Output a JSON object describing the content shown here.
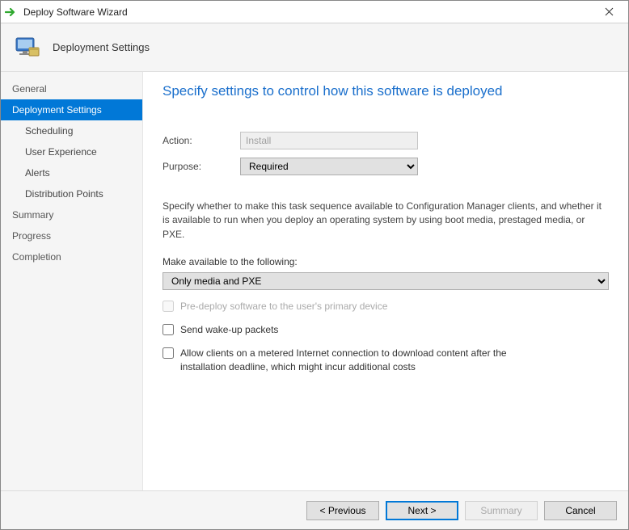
{
  "window": {
    "title": "Deploy Software Wizard"
  },
  "header": {
    "page_label": "Deployment Settings"
  },
  "sidebar": {
    "items": [
      {
        "label": "General"
      },
      {
        "label": "Deployment Settings"
      },
      {
        "label": "Scheduling"
      },
      {
        "label": "User Experience"
      },
      {
        "label": "Alerts"
      },
      {
        "label": "Distribution Points"
      },
      {
        "label": "Summary"
      },
      {
        "label": "Progress"
      },
      {
        "label": "Completion"
      }
    ]
  },
  "main": {
    "heading": "Specify settings to control how this software is deployed",
    "action_label": "Action:",
    "action_value": "Install",
    "purpose_label": "Purpose:",
    "purpose_value": "Required",
    "help_text": "Specify whether to make this task sequence available to Configuration Manager clients, and whether it is available to run when you deploy an operating system by using boot media, prestaged media, or PXE.",
    "available_label": "Make available to the following:",
    "available_value": "Only media and PXE",
    "cb_predeploy": "Pre-deploy software to the user's primary device",
    "cb_wakeup": "Send wake-up packets",
    "cb_metered": "Allow clients on a metered Internet connection to download content after the installation deadline, which might incur additional costs"
  },
  "footer": {
    "previous": "< Previous",
    "next": "Next >",
    "summary": "Summary",
    "cancel": "Cancel"
  }
}
